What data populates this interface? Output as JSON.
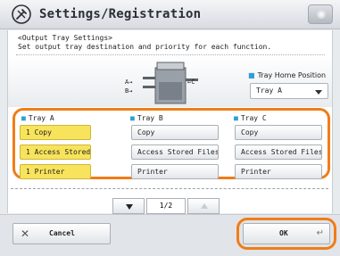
{
  "header": {
    "title": "Settings/Registration",
    "icon": "wrench-gear-icon"
  },
  "instructions": {
    "line1": "<Output Tray Settings>",
    "line2": "Set output tray destination and priority for each function."
  },
  "illustration": {
    "label_a": "A→",
    "label_b": "B→",
    "label_c": "←C"
  },
  "home_position": {
    "label": "Tray Home Position",
    "value": "Tray A"
  },
  "trays": [
    {
      "name": "Tray A",
      "options": [
        {
          "label": "1 Copy",
          "selected": true
        },
        {
          "label": "1 Access Stored Files",
          "selected": true
        },
        {
          "label": "1 Printer",
          "selected": true
        }
      ]
    },
    {
      "name": "Tray B",
      "options": [
        {
          "label": "Copy",
          "selected": false
        },
        {
          "label": "Access Stored Files",
          "selected": false
        },
        {
          "label": "Printer",
          "selected": false
        }
      ]
    },
    {
      "name": "Tray C",
      "options": [
        {
          "label": "Copy",
          "selected": false
        },
        {
          "label": "Access Stored Files",
          "selected": false
        },
        {
          "label": "Printer",
          "selected": false
        }
      ]
    }
  ],
  "pagination": {
    "page": "1/2"
  },
  "footer": {
    "cancel_label": "Cancel",
    "ok_label": "OK"
  },
  "colors": {
    "highlight": "#f07d18",
    "selected": "#f8e35c",
    "bullet": "#2e9fd5"
  }
}
